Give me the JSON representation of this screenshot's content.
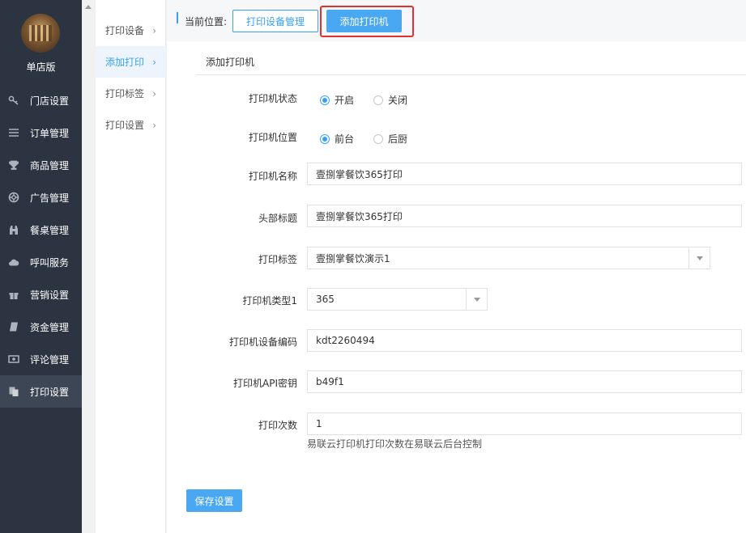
{
  "sidebar": {
    "store_name": "单店版",
    "items": [
      {
        "label": "门店设置",
        "icon": "key-icon"
      },
      {
        "label": "订单管理",
        "icon": "list-icon"
      },
      {
        "label": "商品管理",
        "icon": "trophy-icon"
      },
      {
        "label": "广告管理",
        "icon": "lifebuoy-icon"
      },
      {
        "label": "餐桌管理",
        "icon": "binoculars-icon"
      },
      {
        "label": "呼叫服务",
        "icon": "cloud-icon"
      },
      {
        "label": "营销设置",
        "icon": "gift-icon"
      },
      {
        "label": "资金管理",
        "icon": "book-icon"
      },
      {
        "label": "评论管理",
        "icon": "money-icon"
      },
      {
        "label": "打印设置",
        "icon": "copy-icon"
      }
    ]
  },
  "submenu": {
    "items": [
      {
        "label": "打印设备"
      },
      {
        "label": "添加打印"
      },
      {
        "label": "打印标签"
      },
      {
        "label": "打印设置"
      }
    ]
  },
  "topbar": {
    "location_label": "当前位置:",
    "manage_button": "打印设备管理",
    "add_button": "添加打印机"
  },
  "form": {
    "title": "添加打印机",
    "status": {
      "label": "打印机状态",
      "options": [
        "开启",
        "关闭"
      ]
    },
    "position": {
      "label": "打印机位置",
      "options": [
        "前台",
        "后厨"
      ]
    },
    "name": {
      "label": "打印机名称",
      "value": "壹捌掌餐饮365打印"
    },
    "header": {
      "label": "头部标题",
      "value": "壹捌掌餐饮365打印"
    },
    "tag": {
      "label": "打印标签",
      "value": "壹捌掌餐饮演示1"
    },
    "type": {
      "label": "打印机类型1",
      "value": "365"
    },
    "device_code": {
      "label": "打印机设备编码",
      "value": "kdt2260494"
    },
    "api_key": {
      "label": "打印机API密钥",
      "value": "b49f1"
    },
    "count": {
      "label": "打印次数",
      "value": "1",
      "hint": "易联云打印机打印次数在易联云后台控制"
    },
    "save_button": "保存设置"
  }
}
